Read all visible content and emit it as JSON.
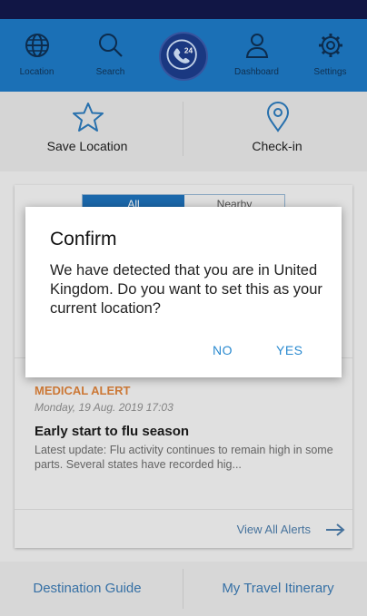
{
  "nav": {
    "items": [
      {
        "label": "Location",
        "icon": "globe-icon"
      },
      {
        "label": "Search",
        "icon": "search-icon"
      },
      {
        "label": "Dashboard",
        "icon": "user-icon"
      },
      {
        "label": "Settings",
        "icon": "gear-icon"
      }
    ],
    "logo": "24"
  },
  "shortcuts": {
    "save_location": "Save Location",
    "check_in": "Check-in"
  },
  "alerts": {
    "toggle_all": "All",
    "toggle_other": "Nearby",
    "category": "MEDICAL ALERT",
    "date": "Monday, 19 Aug. 2019 17:03",
    "title": "Early start to flu season",
    "body": "Latest update: Flu activity continues to remain high in some parts. Several states have recorded hig...",
    "view_all": "View All Alerts"
  },
  "bottom": {
    "destination_guide": "Destination Guide",
    "itinerary": "My Travel Itinerary"
  },
  "dialog": {
    "title": "Confirm",
    "message": "We have detected that you are in United Kingdom. Do you want to set this as your current location?",
    "no": "NO",
    "yes": "YES"
  },
  "colors": {
    "nav_bg": "#1d77c2",
    "status_bar": "#13184a",
    "accent": "#2a8ad0",
    "alert_category": "#d9803a"
  }
}
